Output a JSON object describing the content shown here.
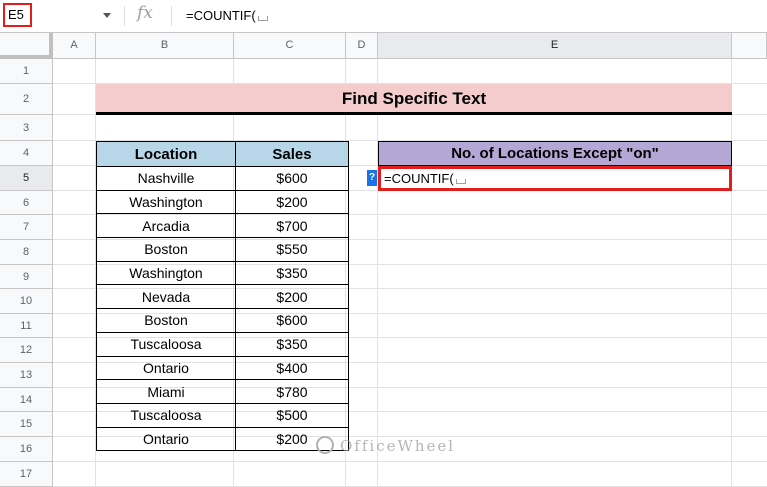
{
  "formula_bar": {
    "name_box": "E5",
    "fx": "fx",
    "formula": "=COUNTIF("
  },
  "columns": [
    "A",
    "B",
    "C",
    "D",
    "E"
  ],
  "rows": [
    "1",
    "2",
    "3",
    "4",
    "5",
    "6",
    "7",
    "8",
    "9",
    "10",
    "11",
    "12",
    "13",
    "14",
    "15",
    "16",
    "17"
  ],
  "title": "Find Specific Text",
  "table": {
    "headers": [
      "Location",
      "Sales"
    ],
    "rows": [
      [
        "Nashville",
        "$600"
      ],
      [
        "Washington",
        "$200"
      ],
      [
        "Arcadia",
        "$700"
      ],
      [
        "Boston",
        "$550"
      ],
      [
        "Washington",
        "$350"
      ],
      [
        "Nevada",
        "$200"
      ],
      [
        "Boston",
        "$600"
      ],
      [
        "Tuscaloosa",
        "$350"
      ],
      [
        "Ontario",
        "$400"
      ],
      [
        "Miami",
        "$780"
      ],
      [
        "Tuscaloosa",
        "$500"
      ],
      [
        "Ontario",
        "$200"
      ]
    ]
  },
  "result": {
    "header": "No. of Locations Except \"on\"",
    "cell_value": "=COUNTIF(",
    "help": "?"
  },
  "watermark": "OfficeWheel",
  "colors": {
    "title_bg": "#f4cccc",
    "table_header_bg": "#b7d7e8",
    "result_header_bg": "#b4a7d6",
    "highlight_border": "#e11d1d"
  }
}
